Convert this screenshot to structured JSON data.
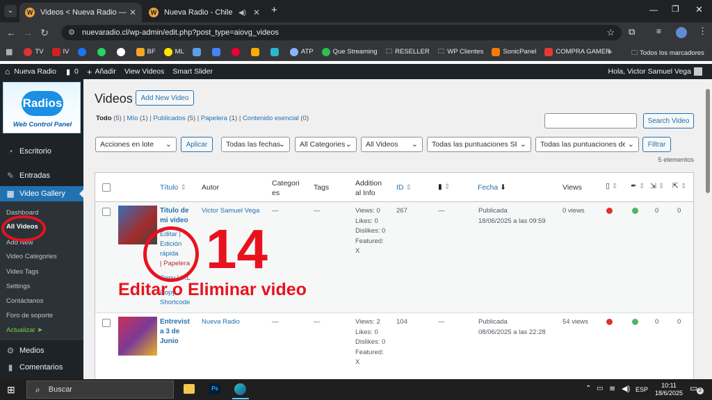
{
  "browser": {
    "tabs": [
      {
        "label": "Videos < Nueva Radio — WordPress",
        "active": true
      },
      {
        "label": "Nueva Radio - Chile",
        "active": false
      }
    ],
    "url": "nuevaradio.cl/wp-admin/edit.php?post_type=aiovg_videos",
    "bookmarks": [
      "TV",
      "IV",
      "",
      "",
      "",
      "BF",
      "ML",
      "",
      "",
      "",
      "",
      "ATP",
      "Que Streaming",
      "RESELLER",
      "WP Clientes",
      "SonicPanel",
      "COMPRA GAMER"
    ],
    "all_bookmarks": "Todos los marcadores"
  },
  "adminbar": {
    "site": "Nueva Radio",
    "comments": "0",
    "add_new": "Añadir",
    "view_videos": "View Videos",
    "smart_slider": "Smart Slider",
    "greeting": "Hola, Victor Samuel Vega"
  },
  "sidebar": {
    "logo_top": "Radios",
    "logo_bottom": "Web Control Panel",
    "menu": {
      "escritorio": "Escritorio",
      "entradas": "Entradas",
      "video_gallery": "Video Gallery",
      "medios": "Medios",
      "comentarios": "Comentarios"
    },
    "submenu": [
      "Dashboard",
      "All Videos",
      "Add New",
      "Video Categories",
      "Video Tags",
      "Settings",
      "Contáctanos",
      "Foro de soporte",
      "Actualizar ➤"
    ]
  },
  "page": {
    "title": "Videos",
    "add_new": "Add New Video",
    "filters": [
      {
        "label": "Todo",
        "count": "(5)"
      },
      {
        "label": "Mío",
        "count": "(1)"
      },
      {
        "label": "Publicados",
        "count": "(5)"
      },
      {
        "label": "Papelera",
        "count": "(1)"
      },
      {
        "label": "Contenido esencial",
        "count": "(0)"
      }
    ],
    "search_button": "Search Video",
    "bulk": "Acciones en lote",
    "apply": "Aplicar",
    "dates": "Todas las fechas",
    "categories": "All Categories",
    "videos": "All Videos",
    "ratings1": "Todas las puntuaciones SEO",
    "ratings2": "Todas las puntuaciones de",
    "filter": "Filtrar",
    "count": "5 elementos"
  },
  "table": {
    "headers": {
      "title": "Título",
      "author": "Autor",
      "categories_1": "Categori",
      "categories_2": "es",
      "tags": "Tags",
      "addinfo_1": "Addition",
      "addinfo_2": "al Info",
      "id": "ID",
      "date": "Fecha",
      "views": "Views"
    },
    "rows": [
      {
        "title_1": "Titulo de",
        "title_2": "mi video",
        "actions": [
          "Editar |",
          "Edición",
          "rápida",
          "| Papelera",
          "Copy URL",
          "Copy",
          "Shortcode"
        ],
        "author": "Victor Samuel Vega",
        "categories": "—",
        "tags": "—",
        "info": [
          "Views: 0",
          "Likes: 0",
          "Dislikes: 0",
          "Featured:",
          "X"
        ],
        "id": "267",
        "comments": "—",
        "status": "Publicada",
        "date": "18/06/2025 a las 09:59",
        "views": "0 views",
        "c1": "0",
        "c2": "0"
      },
      {
        "title_1": "Entrevist",
        "title_2": "a 3 de",
        "title_3": "Junio",
        "author": "Nueva Radio",
        "categories": "—",
        "tags": "—",
        "info": [
          "Views: 2",
          "Likes: 0",
          "Dislikes: 0",
          "Featured:",
          "X"
        ],
        "id": "104",
        "comments": "—",
        "status": "Publicada",
        "date": "08/06/2025 a las 22:28",
        "views": "54 views",
        "c1": "0",
        "c2": "0"
      }
    ]
  },
  "overlay": {
    "number": "14",
    "caption": "Editar o Eliminar video"
  },
  "taskbar": {
    "search": "Buscar",
    "lang": "ESP",
    "time": "10:11",
    "date": "18/6/2025",
    "notif": "2"
  },
  "colors": {
    "accent": "#2271b1",
    "sidebar": "#1d2327",
    "highlight": "#e8121f"
  }
}
